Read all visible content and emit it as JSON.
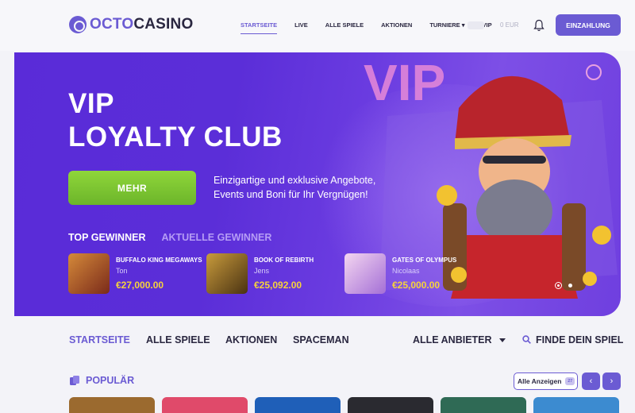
{
  "header": {
    "logo_octo": "OCTO",
    "logo_casino": "CASINO",
    "nav": [
      {
        "label": "STARTSEITE",
        "active": true
      },
      {
        "label": "LIVE",
        "active": false
      },
      {
        "label": "ALLE SPIELE",
        "active": false
      },
      {
        "label": "AKTIONEN",
        "active": false
      },
      {
        "label": "TURNIERE ▾",
        "active": false
      },
      {
        "label": "VIP",
        "active": false
      }
    ],
    "balance": "0 EUR",
    "deposit_label": "EINZAHLUNG"
  },
  "banner": {
    "title_line1": "VIP",
    "title_line2": "LOYALTY CLUB",
    "cta_label": "MEHR",
    "description_line1": "Einzigartige und exklusive Angebote,",
    "description_line2": "Events und Boni für Ihr Vergnügen!",
    "tab_top": "TOP GEWINNER",
    "tab_recent": "AKTUELLE GEWINNER",
    "winners": [
      {
        "game": "BUFFALO KING MEGAWAYS",
        "user": "Ton",
        "amount": "€27,000.00",
        "thumb_color": "#b2532a"
      },
      {
        "game": "BOOK OF REBIRTH",
        "user": "Jens",
        "amount": "€25,092.00",
        "thumb_color": "#6b4a1c"
      },
      {
        "game": "GATES OF OLYMPUS",
        "user": "Nicolaas",
        "amount": "€25,000.00",
        "thumb_color": "#c9a6e8"
      }
    ]
  },
  "subnav": {
    "items": [
      {
        "label": "STARTSEITE",
        "active": true
      },
      {
        "label": "ALLE SPIELE",
        "active": false
      },
      {
        "label": "AKTIONEN",
        "active": false
      },
      {
        "label": "SPACEMAN",
        "active": false
      }
    ],
    "providers_label": "ALLE ANBIETER",
    "search_label": "FINDE DEIN SPIEL"
  },
  "popular": {
    "label": "POPULÄR",
    "show_all_label": "Alle Anzeigen",
    "show_all_badge": "27",
    "prev_icon": "‹",
    "next_icon": "›",
    "game_colors": [
      "#9b6a2f",
      "#e04a6a",
      "#1f5fb8",
      "#2a2a30",
      "#2f6a55",
      "#3c8bd0"
    ]
  },
  "colors": {
    "accent": "#6b5bd3",
    "cta_green": "#7cc531",
    "amount_yellow": "#f6d23c"
  }
}
